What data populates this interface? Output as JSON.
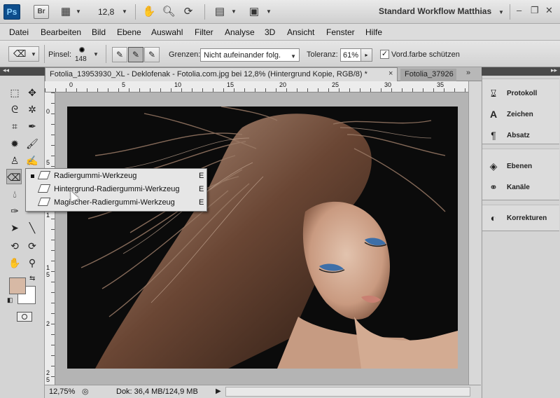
{
  "app": {
    "logo": "Ps",
    "bridge": "Br",
    "zoom": "12,8",
    "workspace": "Standard Workflow Matthias",
    "window_minimize": "–",
    "window_restore": "❐",
    "window_close": "✕"
  },
  "menu": [
    "Datei",
    "Bearbeiten",
    "Bild",
    "Ebene",
    "Auswahl",
    "Filter",
    "Analyse",
    "3D",
    "Ansicht",
    "Fenster",
    "Hilfe"
  ],
  "options": {
    "brush_label": "Pinsel:",
    "brush_size": "148",
    "limits_label": "Grenzen:",
    "limits_value": "Nicht aufeinander folg.",
    "tolerance_label": "Toleranz:",
    "tolerance_value": "61%",
    "protect_label": "Vord.farbe schützen",
    "protect_checked": "✓"
  },
  "document": {
    "tab_active": "Fotolia_13953930_XL - Deklofenak - Fotolia.com.jpg bei 12,8% (Hintergrund Kopie, RGB/8) *",
    "tab_close": "×",
    "tab_inactive": "Fotolia_37926",
    "tab_more": "»",
    "ruler_top": [
      "0",
      "5",
      "10",
      "15",
      "20",
      "25",
      "30",
      "35"
    ],
    "ruler_left": [
      "0",
      "5",
      "1",
      "1",
      "5",
      "2",
      "2",
      "5"
    ]
  },
  "status": {
    "zoom": "12,75%",
    "doc": "Dok: 36,4 MB/124,9 MB"
  },
  "flyout": {
    "items": [
      {
        "label": "Radiergummi-Werkzeug",
        "key": "E"
      },
      {
        "label": "Hintergrund-Radiergummi-Werkzeug",
        "key": "E"
      },
      {
        "label": "Magischer-Radiergummi-Werkzeug",
        "key": "E"
      }
    ]
  },
  "panels": {
    "group1": [
      {
        "icon": "history-icon",
        "label": "Protokoll"
      },
      {
        "icon": "character-icon",
        "label": "Zeichen"
      },
      {
        "icon": "paragraph-icon",
        "label": "Absatz"
      }
    ],
    "group2": [
      {
        "icon": "layers-icon",
        "label": "Ebenen"
      },
      {
        "icon": "channels-icon",
        "label": "Kanäle"
      }
    ],
    "group3": [
      {
        "icon": "adjustments-icon",
        "label": "Korrekturen"
      }
    ]
  },
  "colors": {
    "foreground": "#d7b9a5",
    "background": "#ffffff"
  }
}
